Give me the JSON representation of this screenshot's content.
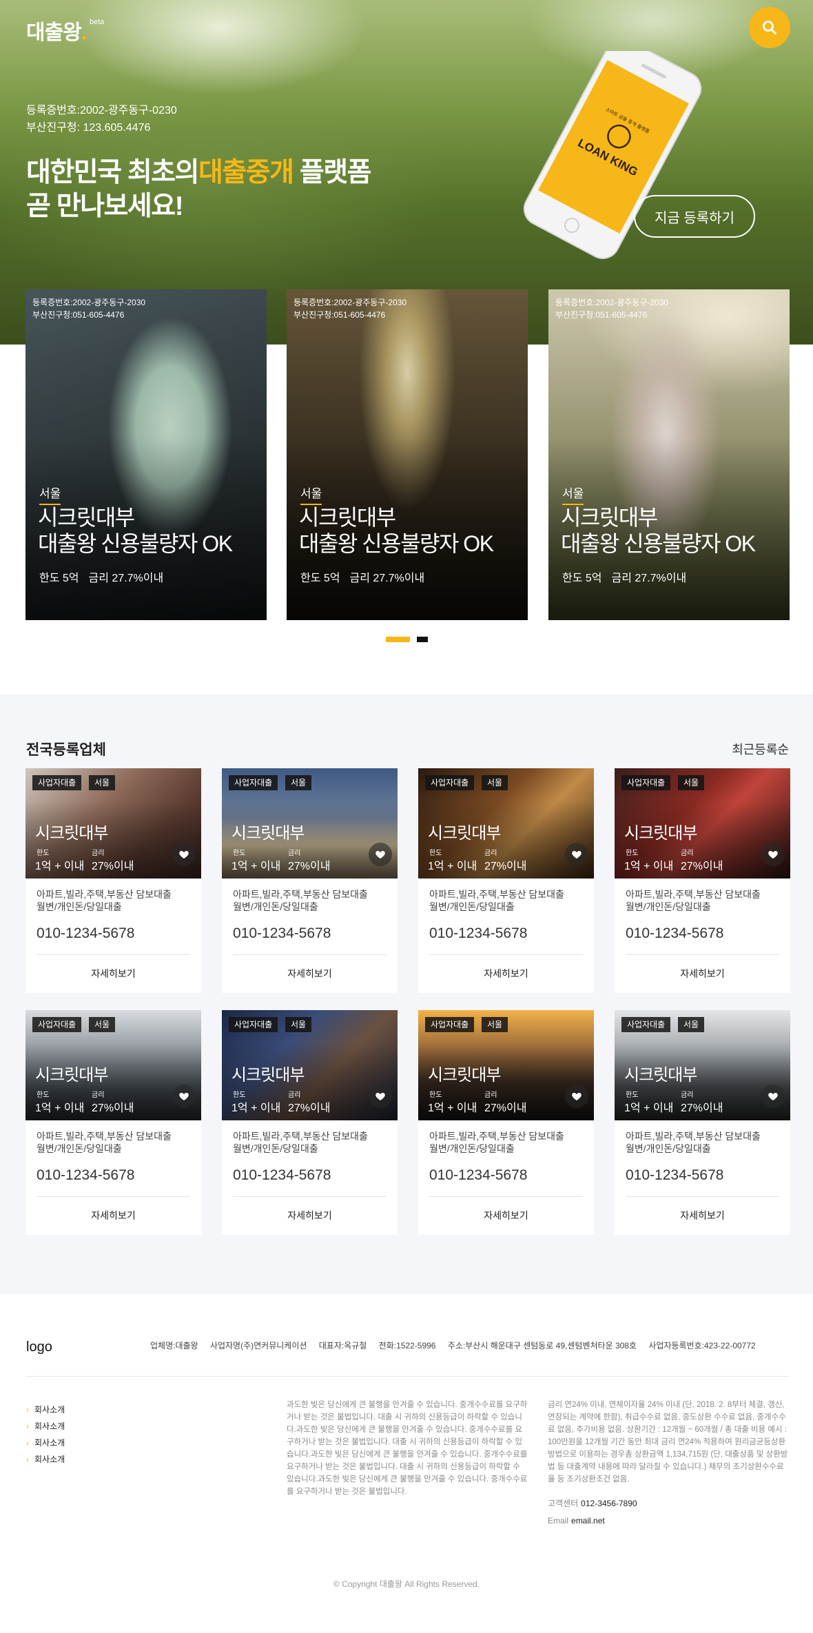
{
  "header": {
    "logo_text": "대출왕",
    "logo_dot": ".",
    "logo_badge": "beta",
    "search_icon": "search-icon"
  },
  "hero": {
    "reg_number": "등록증번호:2002-광주동구-0230",
    "reg_office": "부산진구청: 123.605.4476",
    "headline_pre": "대한민국 최초의",
    "headline_accent": "대출중개",
    "headline_post": " 플랫폼",
    "headline_line2": "곧 만나보세요!",
    "phone_brand": "LOAN KING",
    "phone_caption": "스마트 금융 중개 플랫폼",
    "register_label": "지금 등록하기",
    "accent_color": "#f7b718"
  },
  "features": [
    {
      "reg_number": "등록증번호:2002-광주동구-2030",
      "reg_office": "부산진구청:051-605-4476",
      "city": "서울",
      "title_line1": "시크릿대부",
      "title_line2": "대출왕 신용불량자 OK",
      "limit": "한도 5억",
      "rate": "금리 27.7%이내"
    },
    {
      "reg_number": "등록증번호:2002-광주동구-2030",
      "reg_office": "부산진구청:051-605-4476",
      "city": "서울",
      "title_line1": "시크릿대부",
      "title_line2": "대출왕 신용불량자 OK",
      "limit": "한도 5억",
      "rate": "금리 27.7%이내"
    },
    {
      "reg_number": "등록증번호:2002-광주동구-2030",
      "reg_office": "부산진구청:051-605-4476",
      "city": "서울",
      "title_line1": "시크릿대부",
      "title_line2": "대출왕 신용불량자 OK",
      "limit": "한도 5억",
      "rate": "금리 27.7%이내"
    }
  ],
  "listing": {
    "title": "전국등록업체",
    "sort_label": "최근등록순",
    "cards": [
      {
        "tag1": "사업자대출",
        "tag2": "서울",
        "name": "시크릿대부",
        "limit_label": "한도",
        "limit": "1억 + 이내",
        "rate_label": "금리",
        "rate": "27%이내",
        "desc1": "아파트,빌라,주택,부동산 담보대출",
        "desc2": "월변/개인돈/당일대출",
        "phone": "010-1234-5678",
        "more": "자세히보기"
      },
      {
        "tag1": "사업자대출",
        "tag2": "서울",
        "name": "시크릿대부",
        "limit_label": "한도",
        "limit": "1억 + 이내",
        "rate_label": "금리",
        "rate": "27%이내",
        "desc1": "아파트,빌라,주택,부동산 담보대출",
        "desc2": "월변/개인돈/당일대출",
        "phone": "010-1234-5678",
        "more": "자세히보기"
      },
      {
        "tag1": "사업자대출",
        "tag2": "서울",
        "name": "시크릿대부",
        "limit_label": "한도",
        "limit": "1억 + 이내",
        "rate_label": "금리",
        "rate": "27%이내",
        "desc1": "아파트,빌라,주택,부동산 담보대출",
        "desc2": "월변/개인돈/당일대출",
        "phone": "010-1234-5678",
        "more": "자세히보기"
      },
      {
        "tag1": "사업자대출",
        "tag2": "서울",
        "name": "시크릿대부",
        "limit_label": "한도",
        "limit": "1억 + 이내",
        "rate_label": "금리",
        "rate": "27%이내",
        "desc1": "아파트,빌라,주택,부동산 담보대출",
        "desc2": "월변/개인돈/당일대출",
        "phone": "010-1234-5678",
        "more": "자세히보기"
      },
      {
        "tag1": "사업자대출",
        "tag2": "서울",
        "name": "시크릿대부",
        "limit_label": "한도",
        "limit": "1억 + 이내",
        "rate_label": "금리",
        "rate": "27%이내",
        "desc1": "아파트,빌라,주택,부동산 담보대출",
        "desc2": "월변/개인돈/당일대출",
        "phone": "010-1234-5678",
        "more": "자세히보기"
      },
      {
        "tag1": "사업자대출",
        "tag2": "서울",
        "name": "시크릿대부",
        "limit_label": "한도",
        "limit": "1억 + 이내",
        "rate_label": "금리",
        "rate": "27%이내",
        "desc1": "아파트,빌라,주택,부동산 담보대출",
        "desc2": "월변/개인돈/당일대출",
        "phone": "010-1234-5678",
        "more": "자세히보기"
      },
      {
        "tag1": "사업자대출",
        "tag2": "서울",
        "name": "시크릿대부",
        "limit_label": "한도",
        "limit": "1억 + 이내",
        "rate_label": "금리",
        "rate": "27%이내",
        "desc1": "아파트,빌라,주택,부동산 담보대출",
        "desc2": "월변/개인돈/당일대출",
        "phone": "010-1234-5678",
        "more": "자세히보기"
      },
      {
        "tag1": "사업자대출",
        "tag2": "서울",
        "name": "시크릿대부",
        "limit_label": "한도",
        "limit": "1억 + 이내",
        "rate_label": "금리",
        "rate": "27%이내",
        "desc1": "아파트,빌라,주택,부동산 담보대출",
        "desc2": "월변/개인돈/당일대출",
        "phone": "010-1234-5678",
        "more": "자세히보기"
      }
    ]
  },
  "footer": {
    "logo": "logo",
    "company": "업체명:대출왕",
    "operator": "사업자명(주)연커뮤니케이션",
    "ceo": "대표자:옥규철",
    "tel": "전화:1522-5996",
    "address": "주소:부산시 해운대구 센텀동로 49,센텀벤처타운 308호",
    "biz_no": "사업자등록번호:423-22-00772",
    "nav": [
      "회사소개",
      "회사소개",
      "회사소개",
      "회사소개"
    ],
    "notice1": "과도한 빚은 당신에게 큰 불행을 안겨줄 수 있습니다. 중개수수료를 요구하거나 받는 것은 불법입니다. 대출 시 귀하의 신용등급이 하락할 수 있습니다.과도한 빚은 당신에게 큰 불행을 안겨줄 수 있습니다. 중개수수료를 요구하거나 받는 것은 불법입니다. 대출 시 귀하의 신용등급이 하락할 수 있습니다.과도한 빚은 당신에게 큰 불행을 안겨줄 수 있습니다. 중개수수료를 요구하거나 받는 것은 불법입니다. 대출 시 귀하의 신용등급이 하락할 수 있습니다.과도한 빚은 당신에게 큰 불행을 안겨줄 수 있습니다. 중개수수료를 요구하거나 받는 것은 불법입니다.",
    "notice2": "금리 연24% 이내, 연체이자율 24% 이내 (단, 2018. 2. 8부터 체결, 갱신, 연장되는 계약에 한함), 취급수수료 없음, 중도상환 수수료 없음, 중개수수료 없음, 추가비용 없음. 상환기간 : 12개월 ~ 60개월 / 총 대출 비용 예시 : 100만원을 12개월 기간 동안 최대 금리 연24% 적용하여 원리금균등상환방법으로 이용하는 경우총 상환금액 1,134,715원 (단, 대출상품 및 상환방법 등 대출계약 내용에 따라 달라질 수 있습니다.) 채무의 조기상환수수료율 등 조기상환조건 없음.",
    "cs_label": "고객센터",
    "cs_value": "012-3456-7890",
    "email_label": "Email",
    "email_value": "email.net",
    "copyright": "© Copyright 대출왕 All Rights Reserved."
  }
}
